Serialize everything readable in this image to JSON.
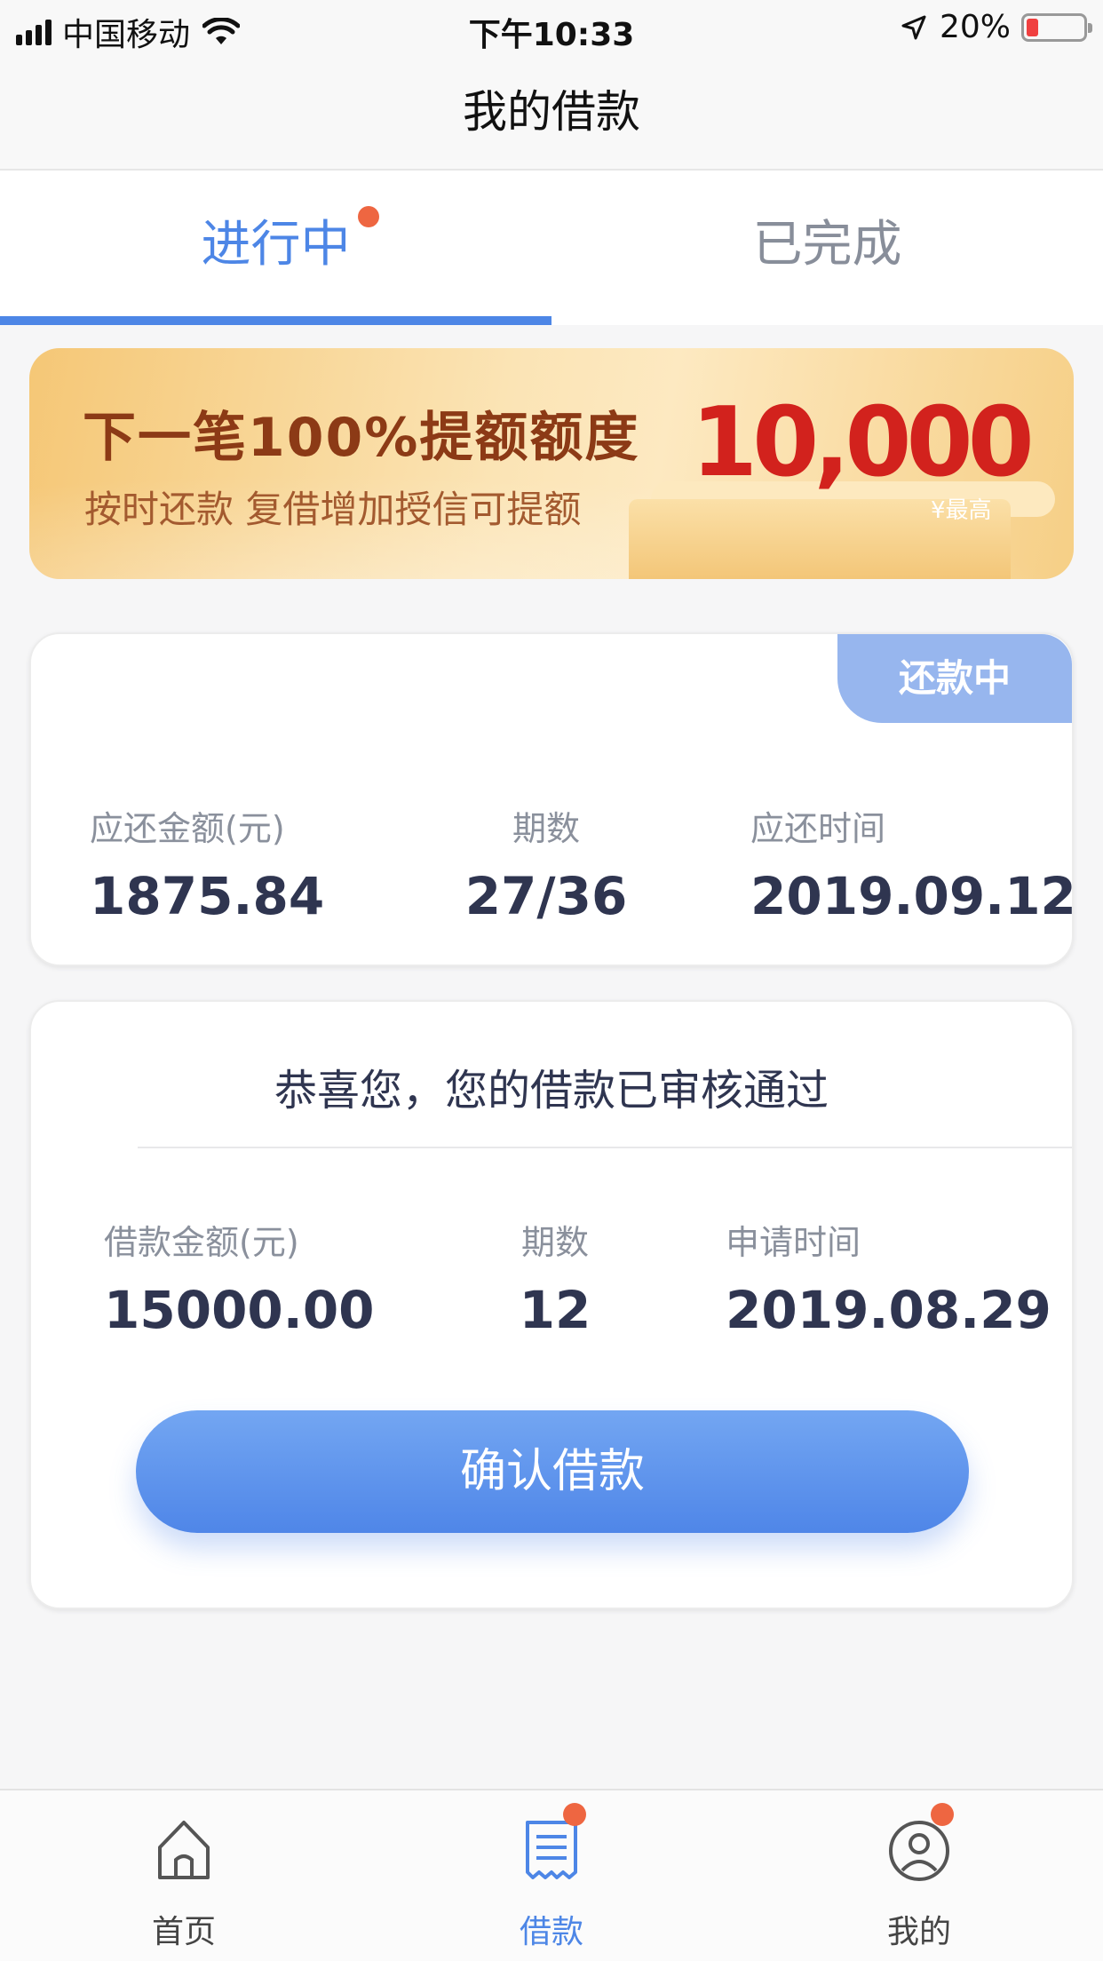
{
  "status_bar": {
    "carrier": "中国移动",
    "time": "下午10:33",
    "battery": "20%"
  },
  "header": {
    "title": "我的借款"
  },
  "tabs": [
    {
      "label": "进行中",
      "active": true,
      "badge": true
    },
    {
      "label": "已完成",
      "active": false,
      "badge": false
    }
  ],
  "banner": {
    "title": "下一笔100%提额额度",
    "subtitle": "按时还款  复借增加授信可提额",
    "amount": "10,000",
    "amount_note": "¥最高"
  },
  "repayment_card": {
    "status": "还款中",
    "columns": [
      {
        "label": "应还金额(元)",
        "value": "1875.84"
      },
      {
        "label": "期数",
        "value": "27/36"
      },
      {
        "label": "应还时间",
        "value": "2019.09.12"
      }
    ]
  },
  "approval_card": {
    "title": "恭喜您，您的借款已审核通过",
    "columns": [
      {
        "label": "借款金额(元)",
        "value": "15000.00"
      },
      {
        "label": "期数",
        "value": "12"
      },
      {
        "label": "申请时间",
        "value": "2019.08.29"
      }
    ],
    "confirm_label": "确认借款"
  },
  "tab_bar": [
    {
      "label": "首页",
      "icon": "home-icon",
      "active": false,
      "badge": false
    },
    {
      "label": "借款",
      "icon": "receipt-icon",
      "active": true,
      "badge": true
    },
    {
      "label": "我的",
      "icon": "profile-icon",
      "active": false,
      "badge": true
    }
  ],
  "colors": {
    "accent": "#4d86e6",
    "badge": "#ee6641",
    "status_tag": "#97b6ee",
    "banner_amount": "#d2221d"
  }
}
